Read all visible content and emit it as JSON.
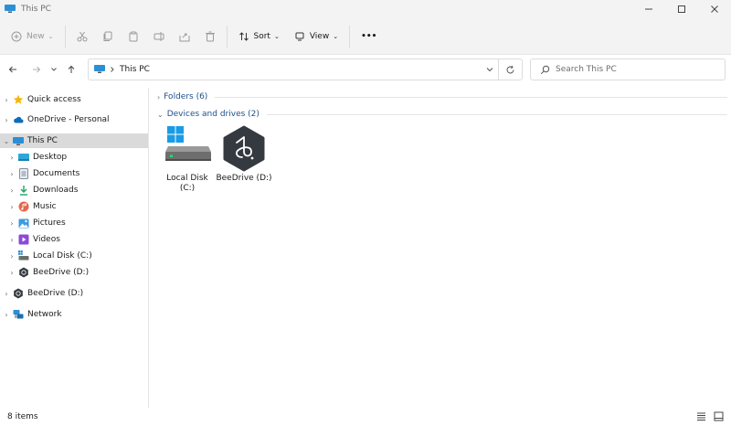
{
  "window": {
    "title": "This PC"
  },
  "command_bar": {
    "new_label": "New",
    "sort_label": "Sort",
    "view_label": "View",
    "more_label": "•••"
  },
  "address_bar": {
    "location": "This PC",
    "search_placeholder": "Search This PC"
  },
  "nav_pane": {
    "items": [
      {
        "label": "Quick access",
        "icon": "star-icon"
      },
      {
        "label": "OneDrive - Personal",
        "icon": "cloud-icon"
      },
      {
        "label": "This PC",
        "icon": "computer-icon"
      },
      {
        "label": "Desktop",
        "icon": "desktop-folder-icon"
      },
      {
        "label": "Documents",
        "icon": "documents-icon"
      },
      {
        "label": "Downloads",
        "icon": "download-icon"
      },
      {
        "label": "Music",
        "icon": "music-icon"
      },
      {
        "label": "Pictures",
        "icon": "pictures-icon"
      },
      {
        "label": "Videos",
        "icon": "videos-icon"
      },
      {
        "label": "Local Disk (C:)",
        "icon": "local-disk-icon"
      },
      {
        "label": "BeeDrive (D:)",
        "icon": "beedrive-icon"
      },
      {
        "label": "BeeDrive (D:)",
        "icon": "beedrive-icon"
      },
      {
        "label": "Network",
        "icon": "network-icon"
      }
    ]
  },
  "content": {
    "folders_header": "Folders (6)",
    "drives_header": "Devices and drives (2)",
    "drives": [
      {
        "label_line1": "Local Disk",
        "label_line2": "(C:)",
        "icon": "local-disk-drive-icon"
      },
      {
        "label_line1": "BeeDrive (D:)",
        "label_line2": "",
        "icon": "beedrive-drive-icon"
      }
    ]
  },
  "status_bar": {
    "item_count": "8 items"
  },
  "colors": {
    "accent": "#0067c0",
    "selection": "#dadada",
    "header_blue": "#1e4f8a"
  }
}
